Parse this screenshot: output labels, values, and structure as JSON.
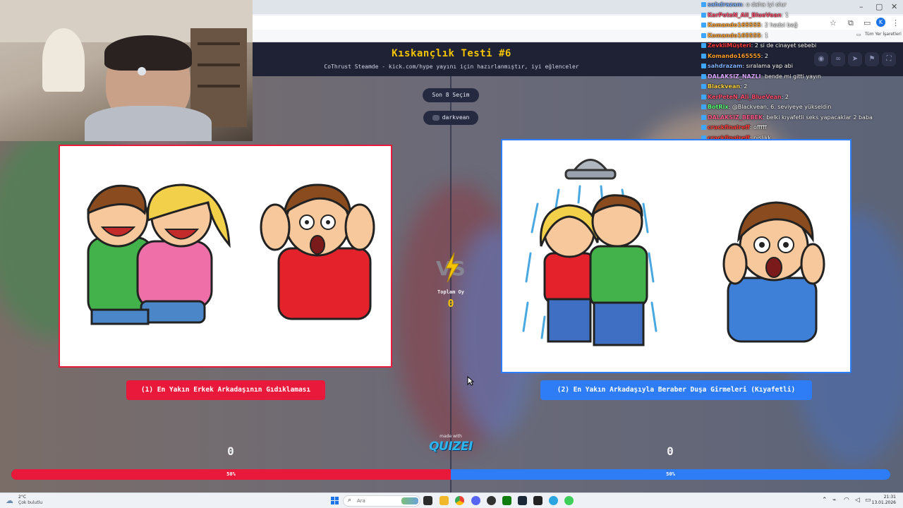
{
  "browser": {
    "window_controls": [
      "–",
      "▢",
      "✕"
    ],
    "bookmarks_label": "Tüm Yer İşaretleri",
    "profile_initial": "K"
  },
  "quiz": {
    "title": "Kıskançlık Testi #6",
    "subtitle": "CoThrust Steamde - kick.com/hype yayını için hazırlanmıştır, iyi eğlenceler",
    "last_picks_button": "Son 8 Seçim",
    "user_pill": "darkvean",
    "option_left": {
      "label": "(1) En Yakın Erkek Arkadaşının Gıdıklaması",
      "score": "0",
      "percent_text": "50%",
      "percent": 50,
      "color": "#e8193a"
    },
    "option_right": {
      "label": "(2) En Yakın Arkadaşıyla Beraber Duşa Girmeleri (Kıyafetli)",
      "score": "0",
      "percent_text": "50%",
      "percent": 50,
      "color": "#2f7df6"
    },
    "total_label": "Toplam Oy",
    "total_value": "0",
    "made_with": "made with",
    "brand": "QUIZEI"
  },
  "chat": [
    {
      "user": "sahdrazam",
      "message": ": o daha iyi olur",
      "color": "#7fb0ff"
    },
    {
      "user": "KerPeteN_Ali_BlueVean",
      "message": ": 1",
      "color": "#ff4d6d"
    },
    {
      "user": "Komando165555",
      "message": ": 2 hadsi bağ",
      "color": "#ff9f2e"
    },
    {
      "user": "Komando165555",
      "message": ": 1",
      "color": "#ff9f2e"
    },
    {
      "user": "ZevkliMüşteri",
      "message": ": 2 si de cinayet sebebi",
      "color": "#ff3b3b"
    },
    {
      "user": "Komando165555",
      "message": ": 2",
      "color": "#ff9f2e"
    },
    {
      "user": "sahdrazam",
      "message": ": sıralama yap abi",
      "color": "#7fb0ff"
    },
    {
      "user": "DALAKSIZ_NAZLI",
      "message": ": bende mi gitti yayın",
      "color": "#d9a7ff"
    },
    {
      "user": "Blackvean",
      "message": ": 2",
      "color": "#ffd23f"
    },
    {
      "user": "KerPeteN_Ali_BlueVean",
      "message": ": 2",
      "color": "#ff4d6d"
    },
    {
      "user": "BotRix",
      "message": ": @Blackvean, 6. seviyeye yükseldin",
      "color": "#5cff7a"
    },
    {
      "user": "DALAKSIZ_BEBEK",
      "message": ": belki kıyafetli seks yapacaklar 2 baba",
      "color": "#ff5a8a"
    },
    {
      "user": "crackfinalreff",
      "message": ": offfff",
      "color": "#ff3b3b"
    },
    {
      "user": "crackfinalreff",
      "message": ": pislikk",
      "color": "#ff3b3b"
    }
  ],
  "taskbar": {
    "weather_temp": "2°C",
    "weather_desc": "Çok bulutlu",
    "search_placeholder": "Ara",
    "time": "21:31",
    "date": "13.01.2026"
  }
}
